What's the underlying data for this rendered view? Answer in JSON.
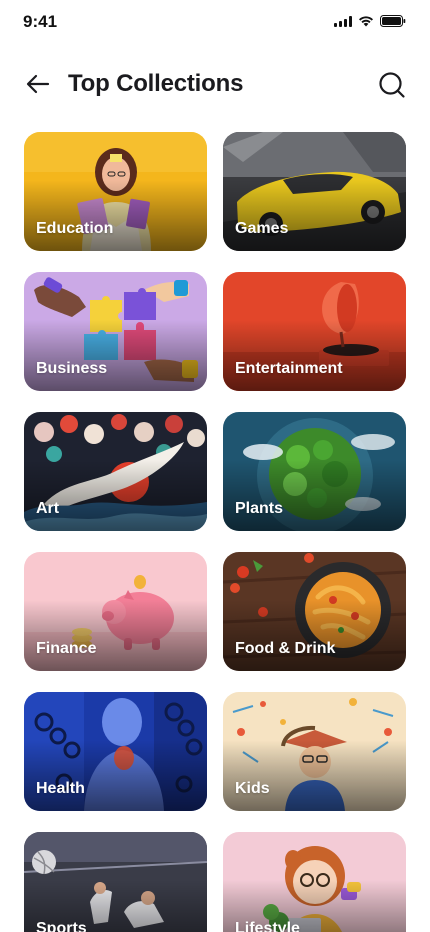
{
  "status_bar": {
    "time": "9:41",
    "icons": [
      "signal-icon",
      "wifi-icon",
      "battery-icon"
    ]
  },
  "header": {
    "title": "Top Collections",
    "back_icon": "arrow-left-icon",
    "search_icon": "search-icon"
  },
  "collections": [
    {
      "label": "Education",
      "art": "education-photo"
    },
    {
      "label": "Games",
      "art": "sports-car-photo"
    },
    {
      "label": "Business",
      "art": "puzzle-hands-photo"
    },
    {
      "label": "Entertainment",
      "art": "gramophone-photo"
    },
    {
      "label": "Art",
      "art": "crane-painting"
    },
    {
      "label": "Plants",
      "art": "green-planet-photo"
    },
    {
      "label": "Finance",
      "art": "piggy-bank-photo"
    },
    {
      "label": "Food & Drink",
      "art": "pasta-photo"
    },
    {
      "label": "Health",
      "art": "anatomy-photo"
    },
    {
      "label": "Kids",
      "art": "kid-doodles-photo"
    },
    {
      "label": "Sports",
      "art": "volleyball-photo"
    },
    {
      "label": "Lifestyle",
      "art": "cartoon-girl-photo"
    }
  ],
  "colors": {
    "text": "#1b1b1f",
    "background": "#ffffff",
    "label": "#ffffff"
  }
}
